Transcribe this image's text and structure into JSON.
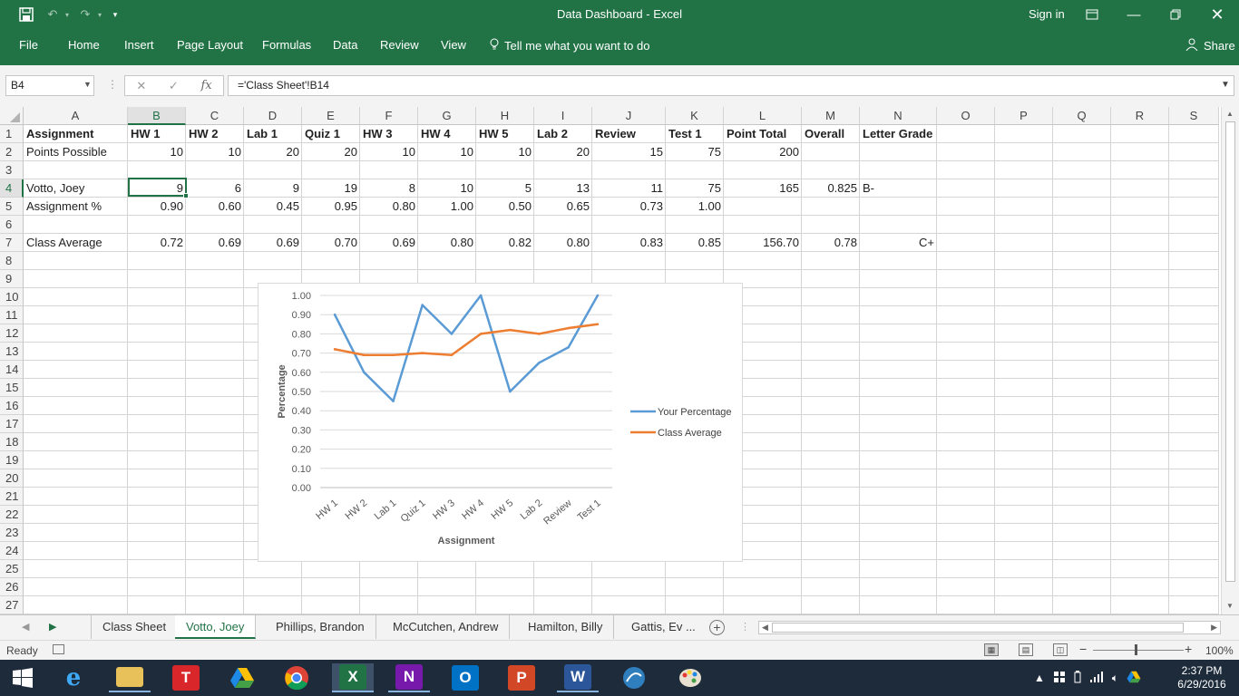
{
  "window": {
    "title": "Data Dashboard - Excel",
    "sign_in": "Sign in",
    "share": "Share",
    "tell_me": "Tell me what you want to do"
  },
  "ribbon_tabs": [
    "File",
    "Home",
    "Insert",
    "Page Layout",
    "Formulas",
    "Data",
    "Review",
    "View"
  ],
  "formula_bar": {
    "name_box": "B4",
    "fx": "fx",
    "formula": "='Class Sheet'!B14"
  },
  "columns": [
    "A",
    "B",
    "C",
    "D",
    "E",
    "F",
    "G",
    "H",
    "I",
    "J",
    "K",
    "L",
    "M",
    "N",
    "O",
    "P",
    "Q",
    "R",
    "S"
  ],
  "rows": [
    "1",
    "2",
    "3",
    "4",
    "5",
    "6",
    "7",
    "8",
    "9",
    "10",
    "11",
    "12",
    "13",
    "14",
    "15",
    "16",
    "17",
    "18",
    "19",
    "20",
    "21",
    "22",
    "23",
    "24",
    "25",
    "26",
    "27"
  ],
  "sheet": {
    "header_row": [
      "Assignment",
      "HW 1",
      "HW 2",
      "Lab 1",
      "Quiz 1",
      "HW 3",
      "HW 4",
      "HW 5",
      "Lab 2",
      "Review",
      "Test 1",
      "Point Total",
      "Overall",
      "Letter Grade"
    ],
    "points_possible": [
      "Points Possible",
      "10",
      "10",
      "20",
      "20",
      "10",
      "10",
      "10",
      "20",
      "15",
      "75",
      "200"
    ],
    "student": [
      "Votto, Joey",
      "9",
      "6",
      "9",
      "19",
      "8",
      "10",
      "5",
      "13",
      "11",
      "75",
      "165",
      "0.825",
      "B-"
    ],
    "assignment_pct": [
      "Assignment %",
      "0.90",
      "0.60",
      "0.45",
      "0.95",
      "0.80",
      "1.00",
      "0.50",
      "0.65",
      "0.73",
      "1.00"
    ],
    "class_average": [
      "Class Average",
      "0.72",
      "0.69",
      "0.69",
      "0.70",
      "0.69",
      "0.80",
      "0.82",
      "0.80",
      "0.83",
      "0.85",
      "156.70",
      "0.78",
      "C+"
    ]
  },
  "chart_data": {
    "type": "line",
    "categories": [
      "HW 1",
      "HW 2",
      "Lab 1",
      "Quiz 1",
      "HW 3",
      "HW 4",
      "HW 5",
      "Lab 2",
      "Review",
      "Test 1"
    ],
    "series": [
      {
        "name": "Your Percentage",
        "values": [
          0.9,
          0.6,
          0.45,
          0.95,
          0.8,
          1.0,
          0.5,
          0.65,
          0.73,
          1.0
        ],
        "color": "#5b9bd5"
      },
      {
        "name": "Class Average",
        "values": [
          0.72,
          0.69,
          0.69,
          0.7,
          0.69,
          0.8,
          0.82,
          0.8,
          0.83,
          0.85
        ],
        "color": "#ed7d31"
      }
    ],
    "y_ticks": [
      "0.00",
      "0.10",
      "0.20",
      "0.30",
      "0.40",
      "0.50",
      "0.60",
      "0.70",
      "0.80",
      "0.90",
      "1.00"
    ],
    "ylim": [
      0,
      1
    ],
    "xlabel": "Assignment",
    "ylabel": "Percentage",
    "grid": true,
    "legend": "right"
  },
  "sheet_tabs": [
    "Class Sheet",
    "Votto, Joey",
    "Phillips, Brandon",
    "McCutchen, Andrew",
    "Hamilton, Billy",
    "Gattis, Ev ..."
  ],
  "active_sheet_tab": "Votto, Joey",
  "status": {
    "ready": "Ready",
    "zoom": "100%"
  },
  "clock": {
    "time": "2:37 PM",
    "date": "6/29/2016"
  },
  "taskbar_apps": [
    "windows-start",
    "internet-explorer",
    "file-explorer",
    "typora",
    "google-drive",
    "chrome",
    "excel",
    "onenote",
    "outlook",
    "powerpoint",
    "word",
    "network",
    "paint"
  ]
}
